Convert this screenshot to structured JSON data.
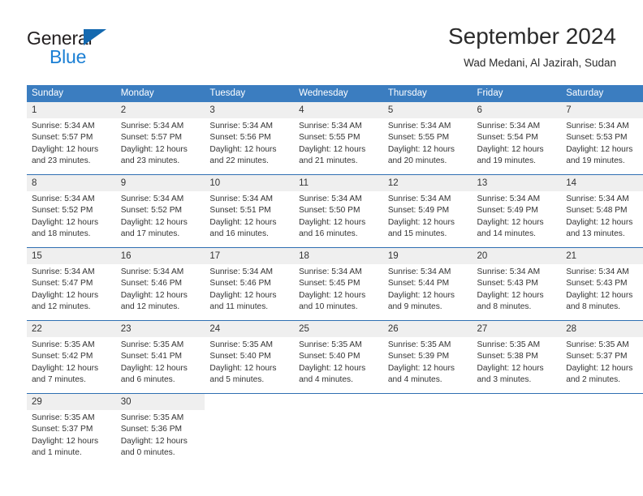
{
  "brand": {
    "name_part1": "General",
    "name_part2": "Blue",
    "accent_color": "#1b7fd4",
    "triangle_color": "#1469b0"
  },
  "header": {
    "title": "September 2024",
    "subtitle": "Wad Medani, Al Jazirah, Sudan"
  },
  "theme": {
    "header_row_bg": "#3b7dc0",
    "row_divider": "#2f6fb2",
    "daynum_bg": "#efefef",
    "text": "#333333"
  },
  "weekday_headers": [
    "Sunday",
    "Monday",
    "Tuesday",
    "Wednesday",
    "Thursday",
    "Friday",
    "Saturday"
  ],
  "weeks": [
    {
      "days": [
        {
          "date": "1",
          "sunrise": "Sunrise: 5:34 AM",
          "sunset": "Sunset: 5:57 PM",
          "daylight": "Daylight: 12 hours and 23 minutes."
        },
        {
          "date": "2",
          "sunrise": "Sunrise: 5:34 AM",
          "sunset": "Sunset: 5:57 PM",
          "daylight": "Daylight: 12 hours and 23 minutes."
        },
        {
          "date": "3",
          "sunrise": "Sunrise: 5:34 AM",
          "sunset": "Sunset: 5:56 PM",
          "daylight": "Daylight: 12 hours and 22 minutes."
        },
        {
          "date": "4",
          "sunrise": "Sunrise: 5:34 AM",
          "sunset": "Sunset: 5:55 PM",
          "daylight": "Daylight: 12 hours and 21 minutes."
        },
        {
          "date": "5",
          "sunrise": "Sunrise: 5:34 AM",
          "sunset": "Sunset: 5:55 PM",
          "daylight": "Daylight: 12 hours and 20 minutes."
        },
        {
          "date": "6",
          "sunrise": "Sunrise: 5:34 AM",
          "sunset": "Sunset: 5:54 PM",
          "daylight": "Daylight: 12 hours and 19 minutes."
        },
        {
          "date": "7",
          "sunrise": "Sunrise: 5:34 AM",
          "sunset": "Sunset: 5:53 PM",
          "daylight": "Daylight: 12 hours and 19 minutes."
        }
      ]
    },
    {
      "days": [
        {
          "date": "8",
          "sunrise": "Sunrise: 5:34 AM",
          "sunset": "Sunset: 5:52 PM",
          "daylight": "Daylight: 12 hours and 18 minutes."
        },
        {
          "date": "9",
          "sunrise": "Sunrise: 5:34 AM",
          "sunset": "Sunset: 5:52 PM",
          "daylight": "Daylight: 12 hours and 17 minutes."
        },
        {
          "date": "10",
          "sunrise": "Sunrise: 5:34 AM",
          "sunset": "Sunset: 5:51 PM",
          "daylight": "Daylight: 12 hours and 16 minutes."
        },
        {
          "date": "11",
          "sunrise": "Sunrise: 5:34 AM",
          "sunset": "Sunset: 5:50 PM",
          "daylight": "Daylight: 12 hours and 16 minutes."
        },
        {
          "date": "12",
          "sunrise": "Sunrise: 5:34 AM",
          "sunset": "Sunset: 5:49 PM",
          "daylight": "Daylight: 12 hours and 15 minutes."
        },
        {
          "date": "13",
          "sunrise": "Sunrise: 5:34 AM",
          "sunset": "Sunset: 5:49 PM",
          "daylight": "Daylight: 12 hours and 14 minutes."
        },
        {
          "date": "14",
          "sunrise": "Sunrise: 5:34 AM",
          "sunset": "Sunset: 5:48 PM",
          "daylight": "Daylight: 12 hours and 13 minutes."
        }
      ]
    },
    {
      "days": [
        {
          "date": "15",
          "sunrise": "Sunrise: 5:34 AM",
          "sunset": "Sunset: 5:47 PM",
          "daylight": "Daylight: 12 hours and 12 minutes."
        },
        {
          "date": "16",
          "sunrise": "Sunrise: 5:34 AM",
          "sunset": "Sunset: 5:46 PM",
          "daylight": "Daylight: 12 hours and 12 minutes."
        },
        {
          "date": "17",
          "sunrise": "Sunrise: 5:34 AM",
          "sunset": "Sunset: 5:46 PM",
          "daylight": "Daylight: 12 hours and 11 minutes."
        },
        {
          "date": "18",
          "sunrise": "Sunrise: 5:34 AM",
          "sunset": "Sunset: 5:45 PM",
          "daylight": "Daylight: 12 hours and 10 minutes."
        },
        {
          "date": "19",
          "sunrise": "Sunrise: 5:34 AM",
          "sunset": "Sunset: 5:44 PM",
          "daylight": "Daylight: 12 hours and 9 minutes."
        },
        {
          "date": "20",
          "sunrise": "Sunrise: 5:34 AM",
          "sunset": "Sunset: 5:43 PM",
          "daylight": "Daylight: 12 hours and 8 minutes."
        },
        {
          "date": "21",
          "sunrise": "Sunrise: 5:34 AM",
          "sunset": "Sunset: 5:43 PM",
          "daylight": "Daylight: 12 hours and 8 minutes."
        }
      ]
    },
    {
      "days": [
        {
          "date": "22",
          "sunrise": "Sunrise: 5:35 AM",
          "sunset": "Sunset: 5:42 PM",
          "daylight": "Daylight: 12 hours and 7 minutes."
        },
        {
          "date": "23",
          "sunrise": "Sunrise: 5:35 AM",
          "sunset": "Sunset: 5:41 PM",
          "daylight": "Daylight: 12 hours and 6 minutes."
        },
        {
          "date": "24",
          "sunrise": "Sunrise: 5:35 AM",
          "sunset": "Sunset: 5:40 PM",
          "daylight": "Daylight: 12 hours and 5 minutes."
        },
        {
          "date": "25",
          "sunrise": "Sunrise: 5:35 AM",
          "sunset": "Sunset: 5:40 PM",
          "daylight": "Daylight: 12 hours and 4 minutes."
        },
        {
          "date": "26",
          "sunrise": "Sunrise: 5:35 AM",
          "sunset": "Sunset: 5:39 PM",
          "daylight": "Daylight: 12 hours and 4 minutes."
        },
        {
          "date": "27",
          "sunrise": "Sunrise: 5:35 AM",
          "sunset": "Sunset: 5:38 PM",
          "daylight": "Daylight: 12 hours and 3 minutes."
        },
        {
          "date": "28",
          "sunrise": "Sunrise: 5:35 AM",
          "sunset": "Sunset: 5:37 PM",
          "daylight": "Daylight: 12 hours and 2 minutes."
        }
      ]
    },
    {
      "days": [
        {
          "date": "29",
          "sunrise": "Sunrise: 5:35 AM",
          "sunset": "Sunset: 5:37 PM",
          "daylight": "Daylight: 12 hours and 1 minute."
        },
        {
          "date": "30",
          "sunrise": "Sunrise: 5:35 AM",
          "sunset": "Sunset: 5:36 PM",
          "daylight": "Daylight: 12 hours and 0 minutes."
        },
        {
          "date": "",
          "sunrise": "",
          "sunset": "",
          "daylight": ""
        },
        {
          "date": "",
          "sunrise": "",
          "sunset": "",
          "daylight": ""
        },
        {
          "date": "",
          "sunrise": "",
          "sunset": "",
          "daylight": ""
        },
        {
          "date": "",
          "sunrise": "",
          "sunset": "",
          "daylight": ""
        },
        {
          "date": "",
          "sunrise": "",
          "sunset": "",
          "daylight": ""
        }
      ]
    }
  ]
}
